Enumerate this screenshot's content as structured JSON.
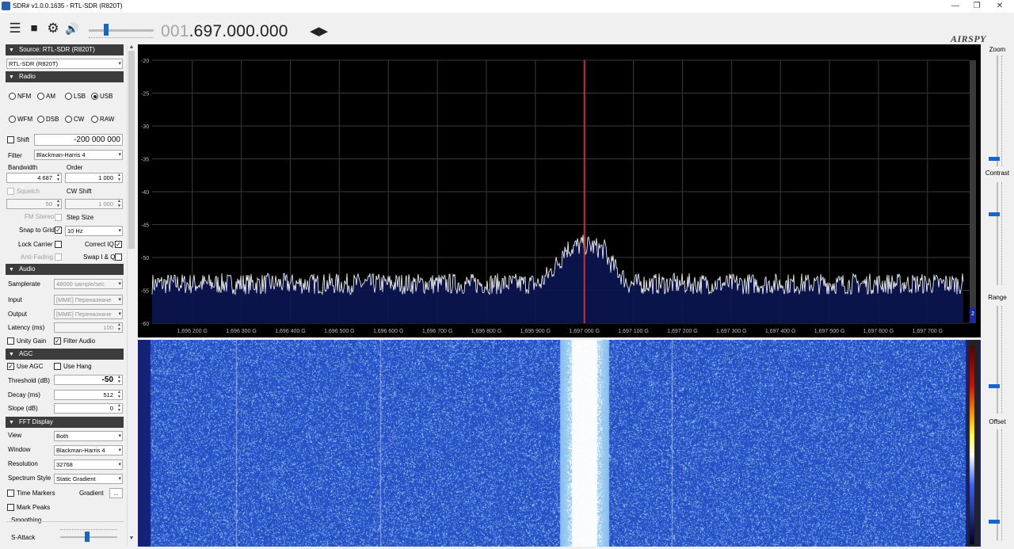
{
  "window": {
    "title": "SDR# v1.0.0.1635 - RTL-SDR (R820T)",
    "minimize": "—",
    "maximize": "❐",
    "close": "✕"
  },
  "toolbar": {
    "freq_dim": "001",
    "freq_lit": ".697.000.000",
    "menu_icon": "☰",
    "stop_icon": "■",
    "gear_icon": "⚙",
    "volume_icon": "🔊",
    "tune_arrows": "◀▶",
    "logo": "AIRSPY",
    "volume_level": 0.25
  },
  "source": {
    "header": "Source: RTL-SDR (R820T)",
    "device": "RTL-SDR (R820T)"
  },
  "radio": {
    "header": "Radio",
    "modes_row1": [
      {
        "label": "NFM",
        "on": false
      },
      {
        "label": "AM",
        "on": false
      },
      {
        "label": "LSB",
        "on": false
      },
      {
        "label": "USB",
        "on": true
      }
    ],
    "modes_row2": [
      {
        "label": "WFM",
        "on": false
      },
      {
        "label": "DSB",
        "on": false
      },
      {
        "label": "CW",
        "on": false
      },
      {
        "label": "RAW",
        "on": false
      }
    ],
    "shift_label": "Shift",
    "shift_value": "-200 000 000",
    "filter_label": "Filter",
    "filter_value": "Blackman-Harris 4",
    "bandwidth_label": "Bandwidth",
    "bandwidth_value": "4 687",
    "order_label": "Order",
    "order_value": "1 000",
    "squelch_label": "Squelch",
    "squelch_value": "50",
    "cwshift_label": "CW Shift",
    "cwshift_value": "1 000",
    "fmstereo_label": "FM Stereo",
    "stepsize_label": "Step Size",
    "snap_label": "Snap to Grid",
    "snap_value": "10 Hz",
    "lockcarrier_label": "Lock Carrier",
    "correctiq_label": "Correct IQ",
    "antifading_label": "Anti-Fading",
    "swapiq_label": "Swap I & Q"
  },
  "audio": {
    "header": "Audio",
    "samplerate_label": "Samplerate",
    "samplerate_value": "48000 sample/sec",
    "input_label": "Input",
    "input_value": "[MME] Переназначе",
    "output_label": "Output",
    "output_value": "[MME] Переназначе",
    "latency_label": "Latency (ms)",
    "latency_value": "100",
    "unity_label": "Unity Gain",
    "filteraudio_label": "Filter Audio"
  },
  "agc": {
    "header": "AGC",
    "useagc_label": "Use AGC",
    "usehang_label": "Use Hang",
    "threshold_label": "Threshold (dB)",
    "threshold_value": "-50",
    "decay_label": "Decay (ms)",
    "decay_value": "512",
    "slope_label": "Slope (dB)",
    "slope_value": "0"
  },
  "fft": {
    "header": "FFT Display",
    "view_label": "View",
    "view_value": "Both",
    "window_label": "Window",
    "window_value": "Blackman-Harris 4",
    "resolution_label": "Resolution",
    "resolution_value": "32768",
    "style_label": "Spectrum Style",
    "style_value": "Static Gradient",
    "timemarkers_label": "Time Markers",
    "gradient_label": "Gradient",
    "gradient_btn": "...",
    "markpeaks_label": "Mark Peaks",
    "smoothing_label": "Smoothing",
    "sattack_label": "S-Attack"
  },
  "right_panel": {
    "zoom": "Zoom",
    "contrast": "Contrast",
    "range": "Range",
    "offset": "Offset"
  },
  "spectrum": {
    "y_ticks": [
      "-20",
      "-25",
      "-30",
      "-35",
      "-40",
      "-45",
      "-50",
      "-55",
      "-60"
    ],
    "x_ticks": [
      "1,696 200 G",
      "1,696 300 G",
      "1,696 400 G",
      "1,696 500 G",
      "1,696 600 G",
      "1,696 700 G",
      "1,696 800 G",
      "1,696 900 G",
      "1,697 000 G",
      "1,697 100 G",
      "1,697 200 G",
      "1,697 300 G",
      "1,697 400 G",
      "1,697 500 G",
      "1,697 600 G",
      "1,697 700 G"
    ],
    "ylim": [
      -60,
      -20
    ],
    "xlim_mhz": [
      1696.118,
      1697.786
    ],
    "center_mhz": 1697.0,
    "noise_floor_db": -54,
    "peak_db": -48,
    "peak_width_mhz": 0.09,
    "zoom_badge": "2",
    "grid_color": "#3a3a3a",
    "trace_color": "#ffffff",
    "fill_color": "#0c1652",
    "marker_color": "#c83228"
  }
}
